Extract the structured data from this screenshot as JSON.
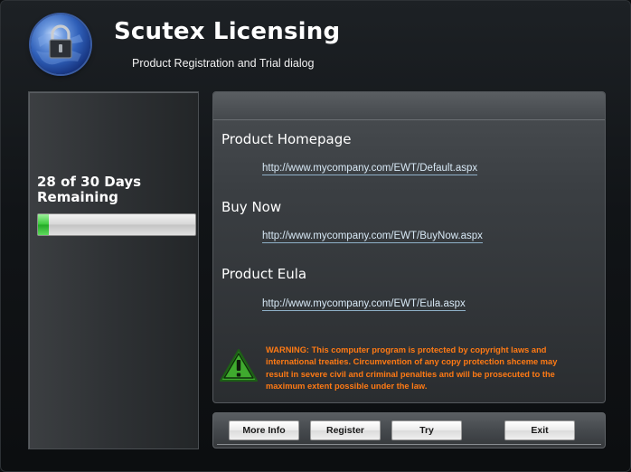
{
  "header": {
    "title": "Scutex Licensing",
    "subtitle": "Product Registration and Trial dialog",
    "logo_icon": "globe-lock-icon"
  },
  "trial": {
    "status": "28 of 30 Days Remaining",
    "days_used": 28,
    "days_total": 30,
    "progress_fraction": 0.07
  },
  "links": [
    {
      "title": "Product Homepage",
      "url": "http://www.mycompany.com/EWT/Default.aspx"
    },
    {
      "title": "Buy Now",
      "url": "http://www.mycompany.com/EWT/BuyNow.aspx"
    },
    {
      "title": "Product Eula",
      "url": "http://www.mycompany.com/EWT/Eula.aspx"
    }
  ],
  "warning": {
    "icon": "warning-icon",
    "text": "WARNING: This computer program is protected by copyright laws and international treaties. Circumvention of any copy protection shceme may result in severe civil and criminal penalties and will be prosecuted to the maximum extent possible under the law.",
    "color": "#ff7a14"
  },
  "buttons": {
    "more_info": "More Info",
    "register": "Register",
    "try": "Try",
    "exit": "Exit"
  },
  "colors": {
    "progress": "#39c83a",
    "warning_icon": "#3faa2e"
  }
}
